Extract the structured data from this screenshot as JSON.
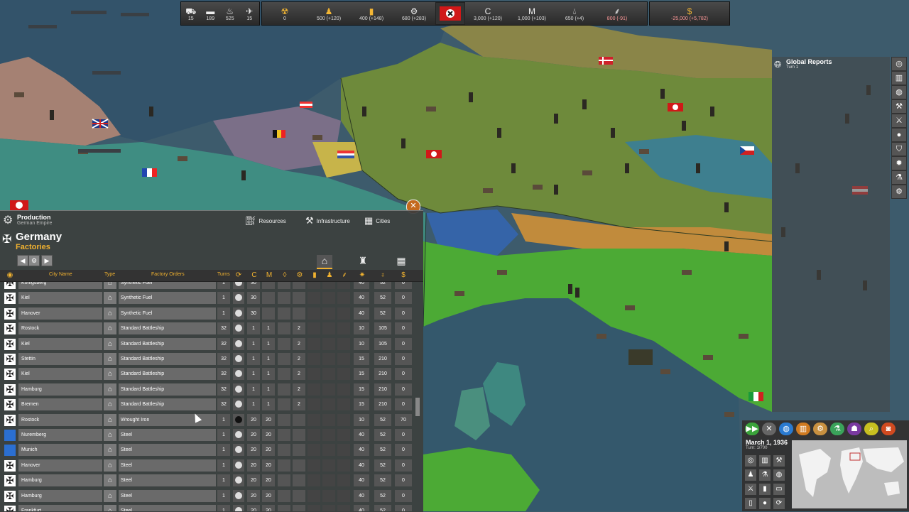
{
  "top_bar": {
    "units": [
      {
        "icon": "truck-icon",
        "value": "15"
      },
      {
        "icon": "tank-icon",
        "value": "189"
      },
      {
        "icon": "flame-icon",
        "value": "525"
      },
      {
        "icon": "plane-icon",
        "value": "15"
      }
    ],
    "resources_left": [
      {
        "icon": "radiation-icon",
        "value": "0"
      },
      {
        "icon": "soldier-icon",
        "value": "500 (+120)"
      },
      {
        "icon": "fuel-icon",
        "value": "400 (+148)"
      },
      {
        "icon": "gear-icon",
        "value": "680 (+283)"
      }
    ],
    "resources_right": [
      {
        "icon": "coal-icon",
        "letter": "C",
        "value": "3,000 (+120)"
      },
      {
        "icon": "metal-icon",
        "letter": "M",
        "value": "1,000 (+103)"
      },
      {
        "icon": "oil-drop-icon",
        "value": "650 (+4)"
      },
      {
        "icon": "wheat-icon",
        "value": "800 (-91)"
      }
    ],
    "money": {
      "icon": "gold-coin-icon",
      "value": "-25,000 (+5,782)"
    }
  },
  "panel": {
    "title": "Production",
    "subtitle": "German Empire",
    "tabs": [
      "Resources",
      "Infrastructure",
      "Cities"
    ],
    "country": "Germany",
    "section": "Factories",
    "columns": {
      "city": "City Name",
      "type": "Type",
      "orders": "Factory Orders",
      "turns": "Turns"
    },
    "rows": [
      {
        "flag": "de",
        "city": "Konigsberg",
        "order": "Synthetic Fuel",
        "turns": "1",
        "a": "30",
        "b": "",
        "c": "",
        "d": "",
        "e": "40",
        "f": "52",
        "g": "0"
      },
      {
        "flag": "de",
        "city": "Kiel",
        "order": "Synthetic Fuel",
        "turns": "1",
        "a": "30",
        "b": "",
        "c": "",
        "d": "",
        "e": "40",
        "f": "52",
        "g": "0"
      },
      {
        "flag": "de",
        "city": "Hanover",
        "order": "Synthetic Fuel",
        "turns": "1",
        "a": "30",
        "b": "",
        "c": "",
        "d": "",
        "e": "40",
        "f": "52",
        "g": "0"
      },
      {
        "flag": "de",
        "city": "Rostock",
        "order": "Standard Battleship",
        "turns": "32",
        "a": "1",
        "b": "1",
        "c": "",
        "d": "2",
        "e": "10",
        "f": "105",
        "g": "0"
      },
      {
        "flag": "de",
        "city": "Kiel",
        "order": "Standard Battleship",
        "turns": "32",
        "a": "1",
        "b": "1",
        "c": "",
        "d": "2",
        "e": "10",
        "f": "105",
        "g": "0"
      },
      {
        "flag": "de",
        "city": "Stettin",
        "order": "Standard Battleship",
        "turns": "32",
        "a": "1",
        "b": "1",
        "c": "",
        "d": "2",
        "e": "15",
        "f": "210",
        "g": "0"
      },
      {
        "flag": "de",
        "city": "Kiel",
        "order": "Standard Battleship",
        "turns": "32",
        "a": "1",
        "b": "1",
        "c": "",
        "d": "2",
        "e": "15",
        "f": "210",
        "g": "0"
      },
      {
        "flag": "de",
        "city": "Hamburg",
        "order": "Standard Battleship",
        "turns": "32",
        "a": "1",
        "b": "1",
        "c": "",
        "d": "2",
        "e": "15",
        "f": "210",
        "g": "0"
      },
      {
        "flag": "de",
        "city": "Bremen",
        "order": "Standard Battleship",
        "turns": "32",
        "a": "1",
        "b": "1",
        "c": "",
        "d": "2",
        "e": "15",
        "f": "210",
        "g": "0"
      },
      {
        "flag": "de",
        "city": "Rostock",
        "order": "Wrought Iron",
        "turns": "1",
        "a": "20",
        "b": "20",
        "c": "",
        "d": "",
        "e": "10",
        "f": "52",
        "g": "70"
      },
      {
        "flag": "bv",
        "city": "Nuremberg",
        "order": "Steel",
        "turns": "1",
        "a": "20",
        "b": "20",
        "c": "",
        "d": "",
        "e": "40",
        "f": "52",
        "g": "0"
      },
      {
        "flag": "bv",
        "city": "Munich",
        "order": "Steel",
        "turns": "1",
        "a": "20",
        "b": "20",
        "c": "",
        "d": "",
        "e": "40",
        "f": "52",
        "g": "0"
      },
      {
        "flag": "de",
        "city": "Hanover",
        "order": "Steel",
        "turns": "1",
        "a": "20",
        "b": "20",
        "c": "",
        "d": "",
        "e": "40",
        "f": "52",
        "g": "0"
      },
      {
        "flag": "de",
        "city": "Hamburg",
        "order": "Steel",
        "turns": "1",
        "a": "20",
        "b": "20",
        "c": "",
        "d": "",
        "e": "40",
        "f": "52",
        "g": "0"
      },
      {
        "flag": "de",
        "city": "Hamburg",
        "order": "Steel",
        "turns": "1",
        "a": "20",
        "b": "20",
        "c": "",
        "d": "",
        "e": "40",
        "f": "52",
        "g": "0"
      },
      {
        "flag": "de",
        "city": "Frankfurt",
        "order": "Steel",
        "turns": "1",
        "a": "20",
        "b": "20",
        "c": "",
        "d": "",
        "e": "40",
        "f": "52",
        "g": "0"
      }
    ]
  },
  "global_reports": {
    "title": "Global Reports",
    "turn": "Turn 1"
  },
  "date_panel": {
    "date": "March 1, 1936",
    "turn": "Turn: 1/700"
  },
  "colors": {
    "gold": "#f1b230",
    "germany": "#6f8a3a",
    "italy": "#4caa35",
    "france": "#3f8f80",
    "sea": "#3b5a6a"
  }
}
